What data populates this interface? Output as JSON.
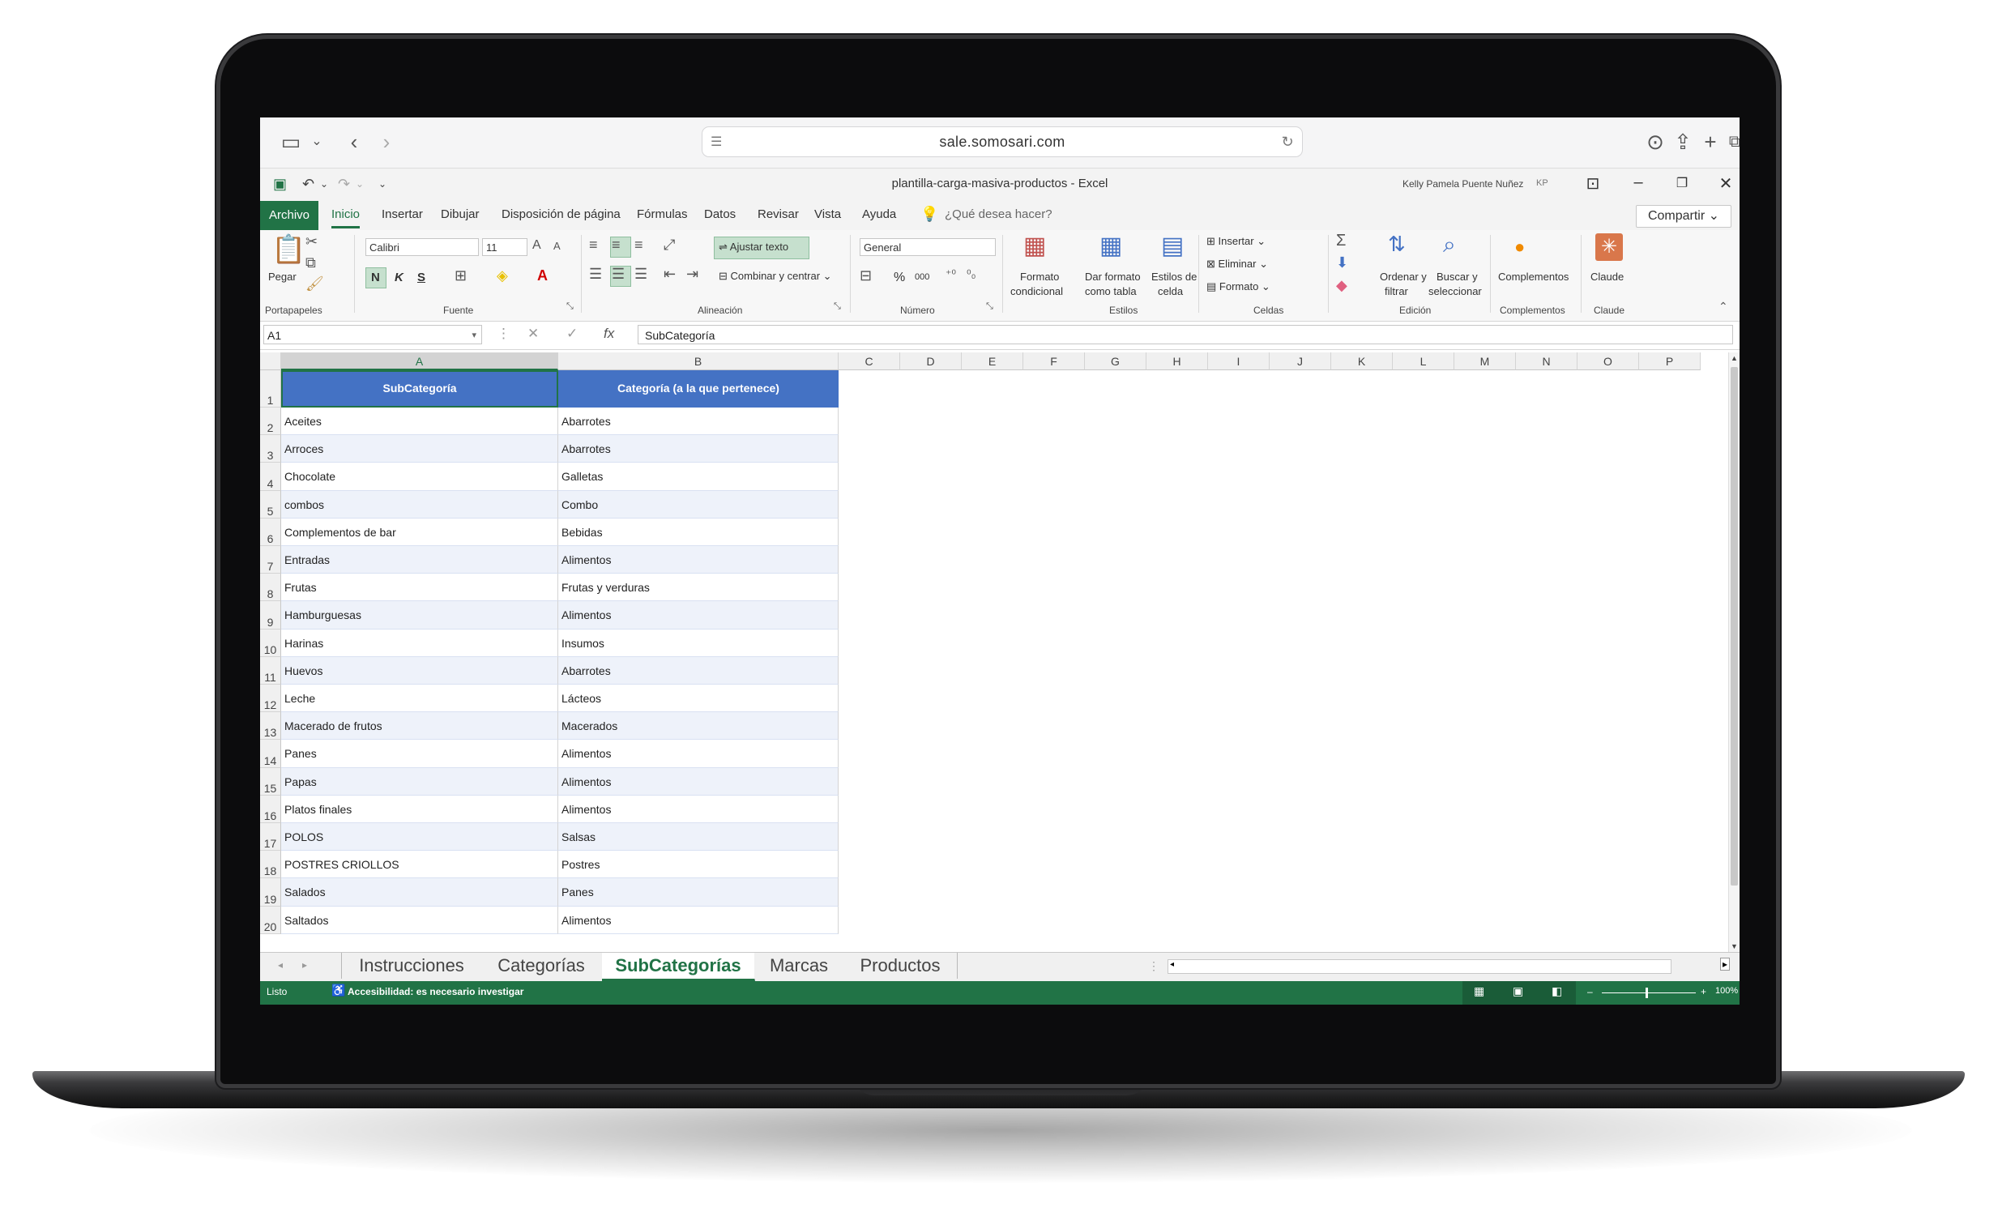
{
  "browser": {
    "url": "sale.somosari.com",
    "icons": [
      "sidebar-icon",
      "chevron-down-icon",
      "back-icon",
      "forward-icon",
      "page-icon",
      "reload-icon",
      "download-icon",
      "share-icon",
      "new-tab-icon",
      "tabs-icon"
    ]
  },
  "window": {
    "title": "plantilla-carga-masiva-productos  -  Excel",
    "user": "Kelly Pamela Puente Nuñez",
    "user_initials": "KP"
  },
  "ribbon_tabs": [
    "Archivo",
    "Inicio",
    "Insertar",
    "Dibujar",
    "Disposición de página",
    "Fórmulas",
    "Datos",
    "Revisar",
    "Vista",
    "Ayuda"
  ],
  "active_tab": "Inicio",
  "search_placeholder": "¿Qué desea hacer?",
  "share_label": "Compartir",
  "ribbon": {
    "paste": "Pegar",
    "font_name": "Calibri",
    "font_size": "11",
    "bold": "N",
    "italic": "K",
    "underline": "S",
    "wrap_text": "Ajustar texto",
    "merge_center": "Combinar y centrar",
    "number_format": "General",
    "percent": "%",
    "thousands": "000",
    "cond_format_1": "Formato",
    "cond_format_2": "condicional",
    "table_format_1": "Dar formato",
    "table_format_2": "como tabla",
    "cell_styles_1": "Estilos de",
    "cell_styles_2": "celda",
    "insert": "Insertar",
    "delete": "Eliminar",
    "format": "Formato",
    "sort_1": "Ordenar y",
    "sort_2": "filtrar",
    "find_1": "Buscar y",
    "find_2": "seleccionar",
    "addins": "Complementos",
    "claude": "Claude",
    "groups": {
      "clipboard": "Portapapeles",
      "font": "Fuente",
      "alignment": "Alineación",
      "number": "Número",
      "styles": "Estilos",
      "cells": "Celdas",
      "editing": "Edición",
      "addins": "Complementos",
      "claude": "Claude"
    },
    "accent": "#217346"
  },
  "formula_bar": {
    "name_box": "A1",
    "value": "SubCategoría"
  },
  "columns": [
    "A",
    "B",
    "C",
    "D",
    "E",
    "F",
    "G",
    "H",
    "I",
    "J",
    "K",
    "L",
    "M",
    "N",
    "O",
    "P"
  ],
  "header_row": {
    "row_number": "1",
    "a": "SubCategoría",
    "b": "Categoría (a la que pertenece)",
    "fill": "#4472c4"
  },
  "rows": [
    {
      "n": "2",
      "a": "Aceites",
      "b": "Abarrotes"
    },
    {
      "n": "3",
      "a": "Arroces",
      "b": "Abarrotes"
    },
    {
      "n": "4",
      "a": "Chocolate",
      "b": "Galletas"
    },
    {
      "n": "5",
      "a": "combos",
      "b": "Combo"
    },
    {
      "n": "6",
      "a": "Complementos de bar",
      "b": "Bebidas"
    },
    {
      "n": "7",
      "a": "Entradas",
      "b": "Alimentos"
    },
    {
      "n": "8",
      "a": "Frutas",
      "b": "Frutas y verduras"
    },
    {
      "n": "9",
      "a": "Hamburguesas",
      "b": "Alimentos"
    },
    {
      "n": "10",
      "a": "Harinas",
      "b": "Insumos"
    },
    {
      "n": "11",
      "a": "Huevos",
      "b": "Abarrotes"
    },
    {
      "n": "12",
      "a": "Leche",
      "b": "Lácteos"
    },
    {
      "n": "13",
      "a": "Macerado de frutos",
      "b": "Macerados"
    },
    {
      "n": "14",
      "a": "Panes",
      "b": "Alimentos"
    },
    {
      "n": "15",
      "a": "Papas",
      "b": "Alimentos"
    },
    {
      "n": "16",
      "a": "Platos finales",
      "b": "Alimentos"
    },
    {
      "n": "17",
      "a": "POLOS",
      "b": "Salsas"
    },
    {
      "n": "18",
      "a": "POSTRES CRIOLLOS",
      "b": "Postres"
    },
    {
      "n": "19",
      "a": "Salados",
      "b": "Panes"
    },
    {
      "n": "20",
      "a": "Saltados",
      "b": "Alimentos"
    }
  ],
  "sheet_tabs": [
    "Instrucciones",
    "Categorías",
    "SubCategorías",
    "Marcas",
    "Productos"
  ],
  "active_sheet": "SubCategorías",
  "status": {
    "ready": "Listo",
    "accessibility": "Accesibilidad: es necesario investigar",
    "zoom": "100%"
  }
}
